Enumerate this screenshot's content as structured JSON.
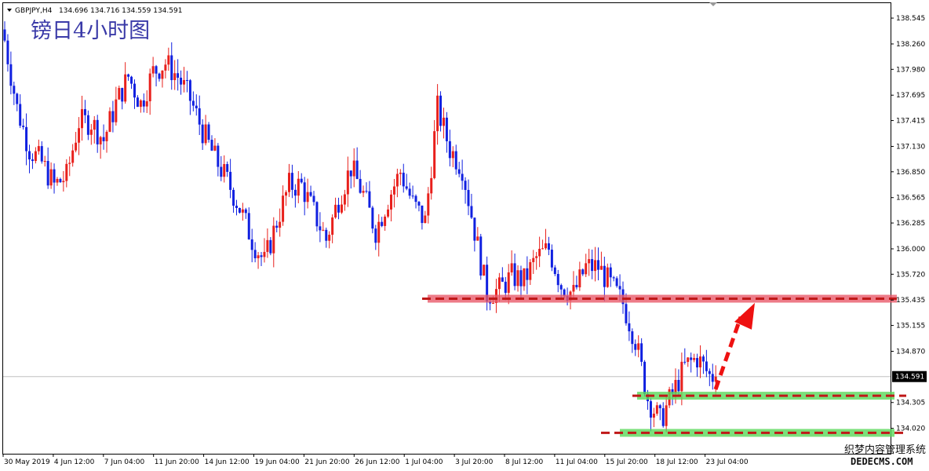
{
  "header": {
    "symbol": "GBPJPY,H4",
    "ohlc": "134.696 134.716 134.559 134.591"
  },
  "overlay_title": "镑日4小时图",
  "watermark": {
    "line1": "织梦内容管理系统",
    "line2": "DEDECMS.COM"
  },
  "current_price_label": "134.591",
  "colors": {
    "bull": "#e8201c",
    "bear": "#1020e0",
    "resistance_band": "#e85a6a",
    "support_band": "#5ad85a",
    "dashed_line": "#c01818",
    "arrow": "#ee1111",
    "current_price_line": "#c0c0c0"
  },
  "chart_data": {
    "type": "candlestick",
    "instrument": "GBPJPY",
    "timeframe": "H4",
    "ylim": [
      133.74,
      138.71
    ],
    "y_ticks": [
      "138.545",
      "138.260",
      "137.980",
      "137.695",
      "137.415",
      "137.130",
      "136.850",
      "136.565",
      "136.285",
      "136.000",
      "135.720",
      "135.435",
      "135.155",
      "134.870",
      "134.305",
      "134.020"
    ],
    "x_ticks": [
      "30 May 2019",
      "4 Jun 12:00",
      "7 Jun 04:00",
      "11 Jun 20:00",
      "14 Jun 12:00",
      "19 Jun 04:00",
      "21 Jun 20:00",
      "26 Jun 12:00",
      "1 Jul 04:00",
      "3 Jul 20:00",
      "8 Jul 12:00",
      "11 Jul 04:00",
      "15 Jul 20:00",
      "18 Jul 12:00",
      "23 Jul 04:00"
    ],
    "price_path": [
      [
        0,
        138.3
      ],
      [
        4,
        137.55
      ],
      [
        8,
        137.1
      ],
      [
        12,
        136.95
      ],
      [
        16,
        136.7
      ],
      [
        20,
        136.8
      ],
      [
        24,
        137.4
      ],
      [
        28,
        137.4
      ],
      [
        32,
        137.2
      ],
      [
        36,
        137.6
      ],
      [
        40,
        137.9
      ],
      [
        44,
        137.6
      ],
      [
        48,
        137.95
      ],
      [
        52,
        138.05
      ],
      [
        56,
        137.9
      ],
      [
        60,
        137.65
      ],
      [
        64,
        137.3
      ],
      [
        68,
        137.0
      ],
      [
        72,
        136.75
      ],
      [
        76,
        136.45
      ],
      [
        80,
        136.1
      ],
      [
        84,
        135.85
      ],
      [
        88,
        136.3
      ],
      [
        92,
        136.7
      ],
      [
        96,
        136.7
      ],
      [
        100,
        136.4
      ],
      [
        104,
        136.1
      ],
      [
        108,
        136.55
      ],
      [
        112,
        136.9
      ],
      [
        116,
        136.6
      ],
      [
        120,
        136.2
      ],
      [
        124,
        136.55
      ],
      [
        128,
        136.85
      ],
      [
        132,
        136.5
      ],
      [
        136,
        136.3
      ],
      [
        140,
        137.55
      ],
      [
        144,
        137.1
      ],
      [
        148,
        136.9
      ],
      [
        152,
        136.2
      ],
      [
        156,
        135.5
      ],
      [
        160,
        135.55
      ],
      [
        164,
        135.7
      ],
      [
        168,
        135.65
      ],
      [
        172,
        135.9
      ],
      [
        176,
        136.0
      ],
      [
        180,
        135.6
      ],
      [
        184,
        135.5
      ],
      [
        188,
        135.8
      ],
      [
        192,
        135.8
      ],
      [
        196,
        135.6
      ],
      [
        200,
        135.4
      ],
      [
        204,
        135.0
      ],
      [
        208,
        134.35
      ],
      [
        212,
        134.1
      ],
      [
        216,
        134.4
      ],
      [
        220,
        134.7
      ],
      [
        224,
        134.8
      ],
      [
        228,
        134.6
      ],
      [
        230,
        134.591
      ]
    ],
    "support_resistance": [
      {
        "type": "resistance",
        "price": 135.45
      },
      {
        "type": "support",
        "price": 134.38
      },
      {
        "type": "support",
        "price": 133.97
      }
    ],
    "projection_arrow": {
      "from_price": 134.45,
      "to_price": 135.3
    },
    "current_price": 134.591
  }
}
